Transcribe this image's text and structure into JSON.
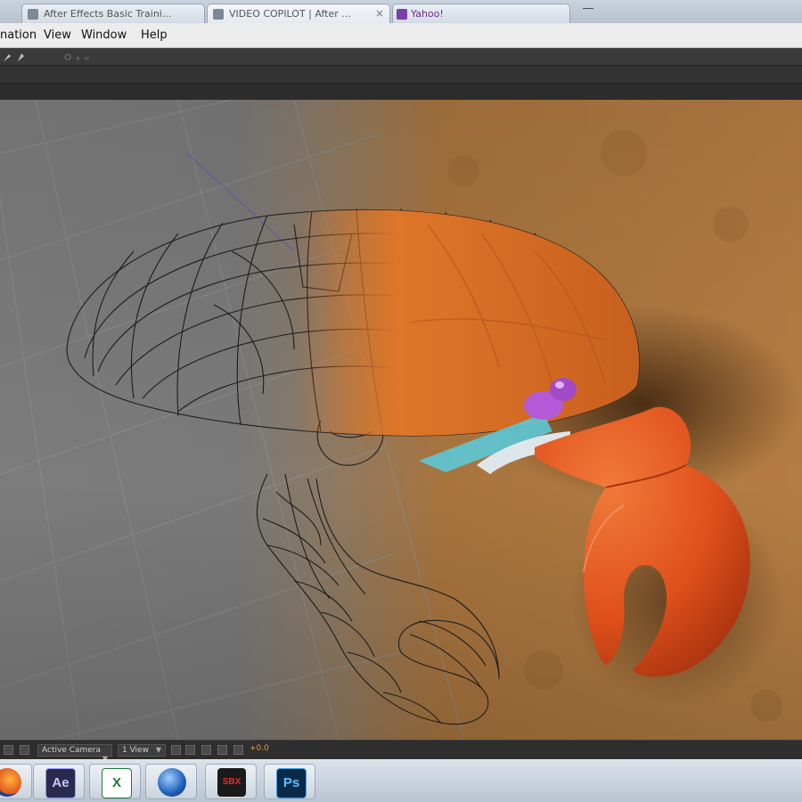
{
  "browser": {
    "tabs": [
      {
        "label": "After Effects Basic Traini..."
      },
      {
        "label": "VIDEO COPILOT | After ..."
      },
      {
        "label": "Yahoo!"
      }
    ],
    "new_tab_icon": "new-tab-icon"
  },
  "menubar": {
    "items": [
      {
        "label": "nation"
      },
      {
        "label": "View"
      },
      {
        "label": "Window"
      },
      {
        "label": "Help"
      }
    ]
  },
  "comp_controls": {
    "camera_select": "Active Camera",
    "view_select": "1 View",
    "exposure_value": "+0.0"
  },
  "taskbar": {
    "apps": [
      {
        "icon": "firefox-icon"
      },
      {
        "icon": "after-effects-icon",
        "label": "Ae"
      },
      {
        "icon": "excel-icon",
        "label": "X"
      },
      {
        "icon": "globe-icon"
      },
      {
        "icon": "3ds-max-icon",
        "label": "SBX"
      },
      {
        "icon": "photoshop-icon",
        "label": "Ps"
      }
    ]
  },
  "colors": {
    "wire_bg": "#7a7a7a",
    "sand": "#b07a40",
    "shell": "#e07a2a",
    "claw": "#e2521c",
    "eye": "#b45ad8",
    "cyan_joint": "#5cc8d6"
  }
}
